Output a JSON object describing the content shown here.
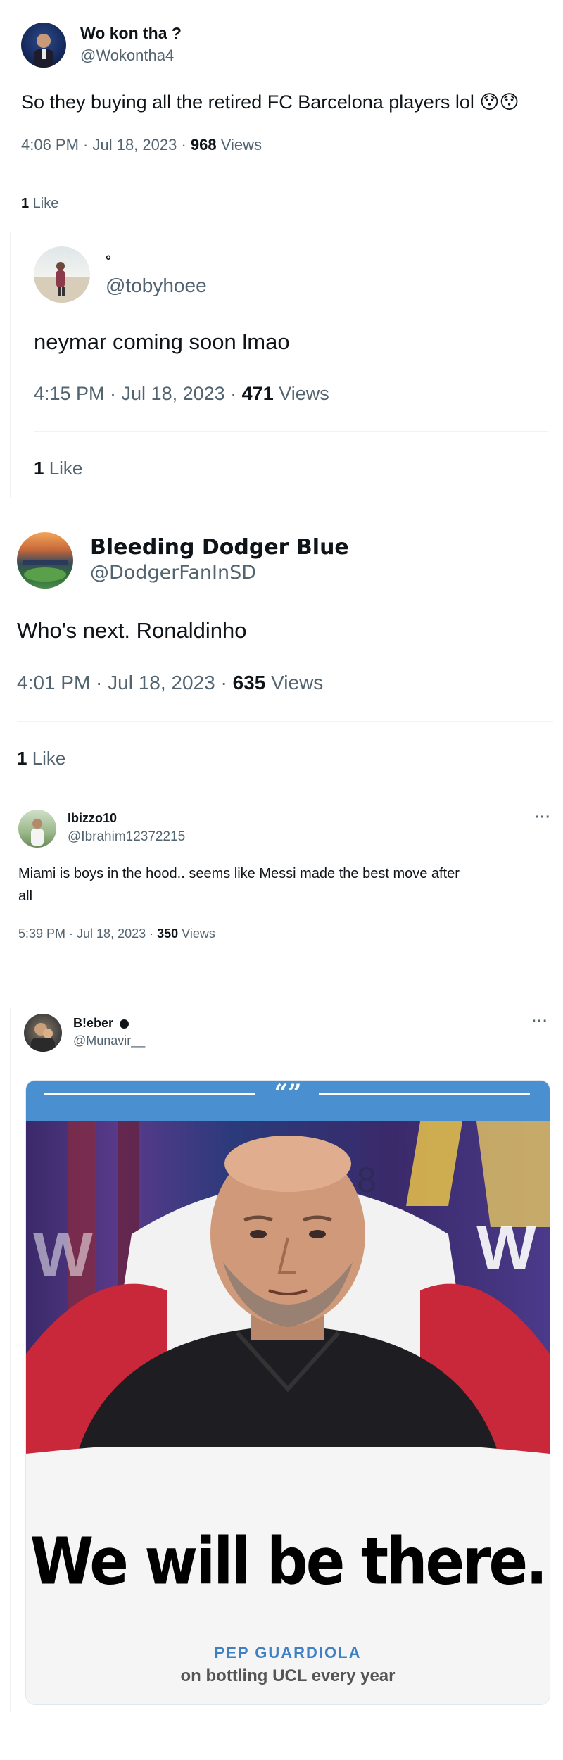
{
  "tweets": [
    {
      "name": "Wo kon tha ?",
      "handle": "@Wokontha4",
      "text": "So they buying all the retired FC Barcelona players lol 😯😯",
      "time": "4:06 PM · Jul 18, 2023 · ",
      "views_count": "968",
      "views_label": " Views",
      "likes_count": "1",
      "likes_label": " Like"
    },
    {
      "name": "°",
      "handle": "@tobyhoee",
      "text": "neymar coming soon lmao",
      "time": "4:15 PM · Jul 18, 2023 · ",
      "views_count": "471",
      "views_label": " Views",
      "likes_count": "1",
      "likes_label": " Like"
    },
    {
      "name": "Bleeding Dodger Blue",
      "handle": "@DodgerFanInSD",
      "text": "Who's next.  Ronaldinho",
      "time": "4:01 PM · Jul 18, 2023 · ",
      "views_count": "635",
      "views_label": " Views",
      "likes_count": "1",
      "likes_label": " Like"
    },
    {
      "name": "Ibizzo10",
      "handle": "@Ibrahim12372215",
      "text_line1": "Miami is boys in the hood.. seems like Messi made the best move after",
      "text_line2": "all",
      "time": "5:39 PM · Jul 18, 2023 · ",
      "views_count": "350",
      "views_label": " Views",
      "more": "···"
    },
    {
      "name": "B!eber",
      "handle": "@Munavir__",
      "more": "···",
      "card": {
        "quote_mark": "“”",
        "headline": "We will be there.",
        "attribution": "PEP GUARDIOLA",
        "caption": "on bottling UCL every year"
      }
    }
  ],
  "colors": {
    "text_primary": "#0f1419",
    "text_secondary": "#536471",
    "divider": "#eff3f4",
    "card_blue": "#4a8fd0",
    "attribution_blue": "#3f7fc4"
  }
}
